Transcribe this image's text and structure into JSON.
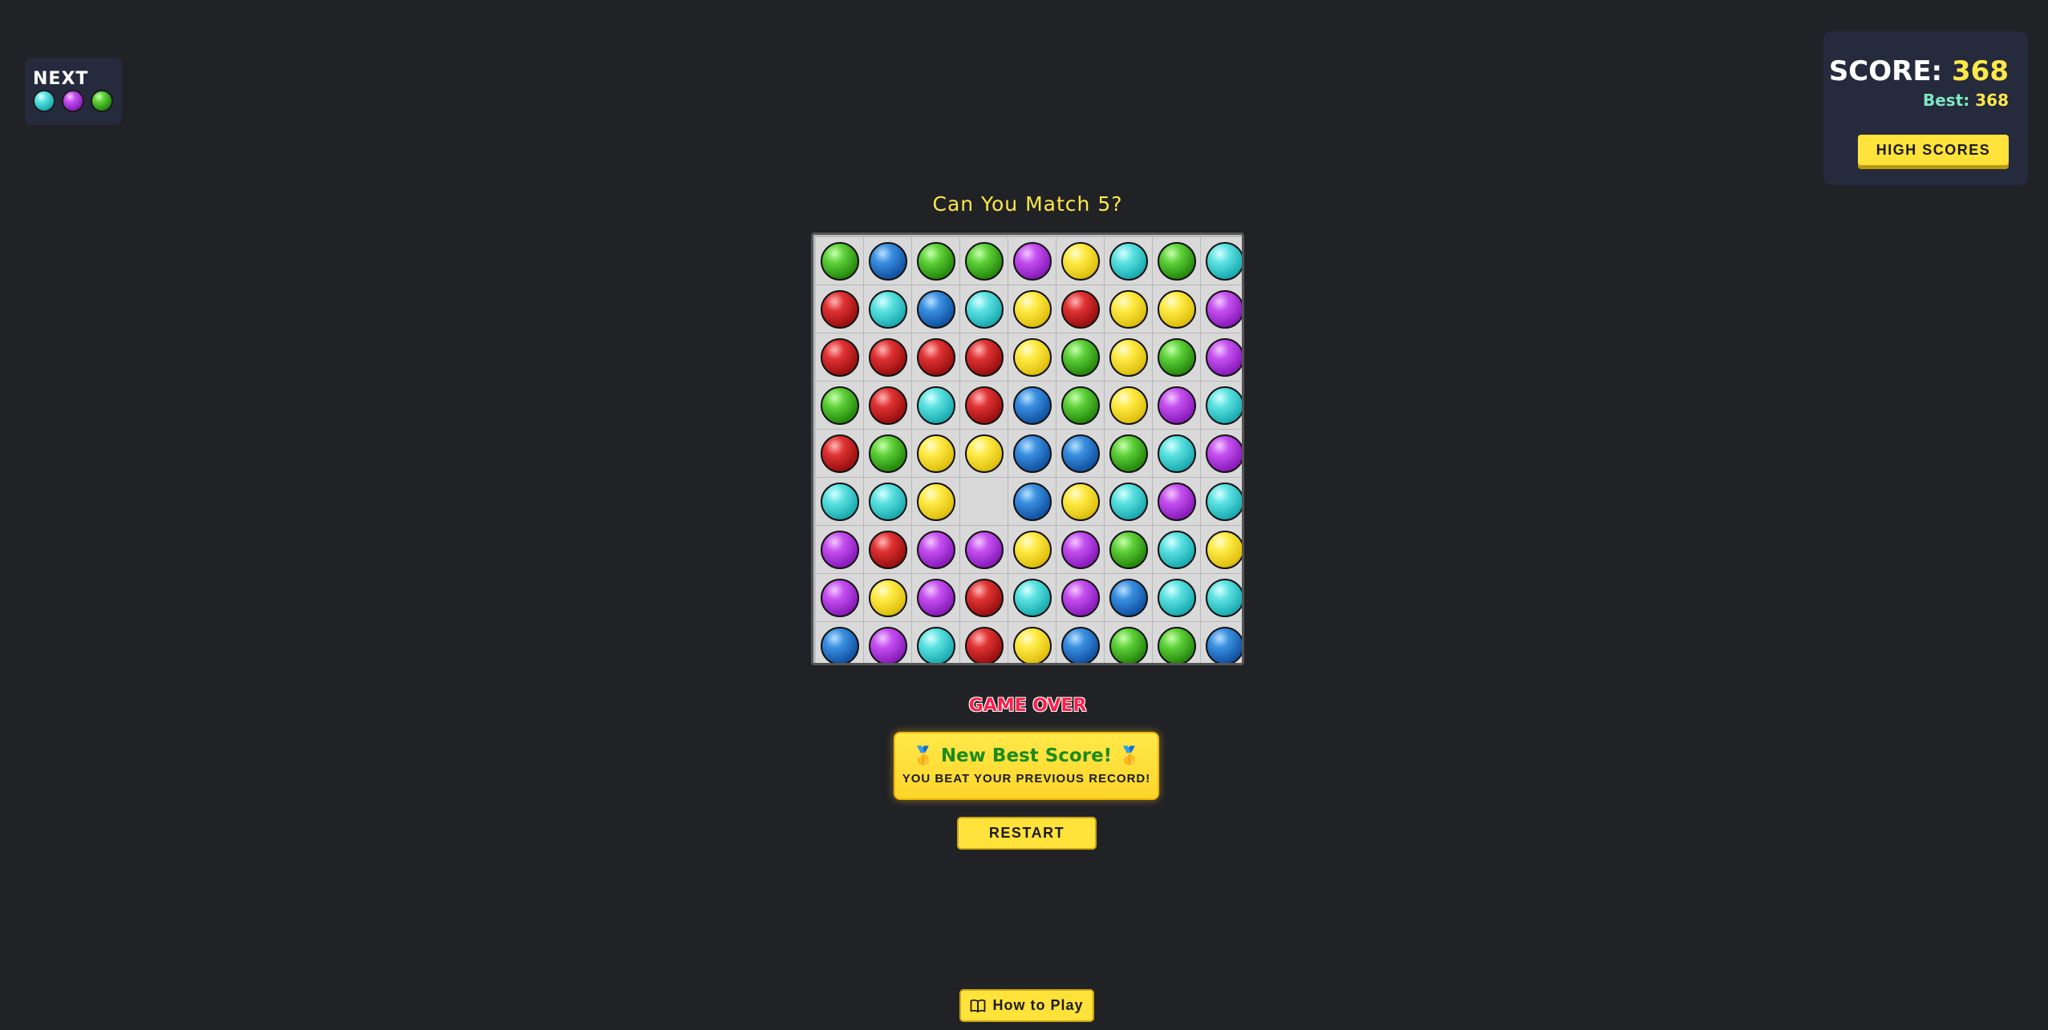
{
  "next": {
    "label": "NEXT",
    "balls": [
      "cyan",
      "purple",
      "green"
    ]
  },
  "score": {
    "label": "SCORE:",
    "value": "368",
    "best_label": "Best:",
    "best_value": "368",
    "high_scores_label": "HIGH SCORES"
  },
  "title": "Can You Match 5?",
  "board": {
    "rows": 9,
    "cols": 9,
    "cells": [
      [
        "green",
        "blue",
        "green",
        "green",
        "purple",
        "yellow",
        "cyan",
        "green",
        "cyan"
      ],
      [
        "red",
        "cyan",
        "blue",
        "cyan",
        "yellow",
        "red",
        "yellow",
        "yellow",
        "purple"
      ],
      [
        "red",
        "red",
        "red",
        "red",
        "yellow",
        "green",
        "yellow",
        "green",
        "purple"
      ],
      [
        "green",
        "red",
        "cyan",
        "red",
        "blue",
        "green",
        "yellow",
        "purple",
        "cyan"
      ],
      [
        "red",
        "green",
        "yellow",
        "yellow",
        "blue",
        "blue",
        "green",
        "cyan",
        "purple"
      ],
      [
        "cyan",
        "cyan",
        "yellow",
        "",
        "blue",
        "yellow",
        "cyan",
        "purple",
        "cyan"
      ],
      [
        "purple",
        "red",
        "purple",
        "purple",
        "yellow",
        "purple",
        "green",
        "cyan",
        "yellow"
      ],
      [
        "purple",
        "yellow",
        "purple",
        "red",
        "cyan",
        "purple",
        "blue",
        "cyan",
        "cyan"
      ],
      [
        "blue",
        "purple",
        "cyan",
        "red",
        "yellow",
        "blue",
        "green",
        "green",
        "blue"
      ]
    ]
  },
  "game_over": {
    "label": "GAME OVER",
    "best_title": "New Best Score!",
    "medal_icon": "🥇",
    "best_subtitle": "YOU BEAT YOUR PREVIOUS RECORD!",
    "restart_label": "RESTART"
  },
  "how_to_play": {
    "label": "How to Play",
    "icon": "book-icon"
  },
  "colors": {
    "background": "#212226",
    "panel": "#262a3d",
    "accent_yellow": "#ffe23a",
    "game_over_red": "#ff1e4a",
    "best_green": "#1d8b1d"
  }
}
